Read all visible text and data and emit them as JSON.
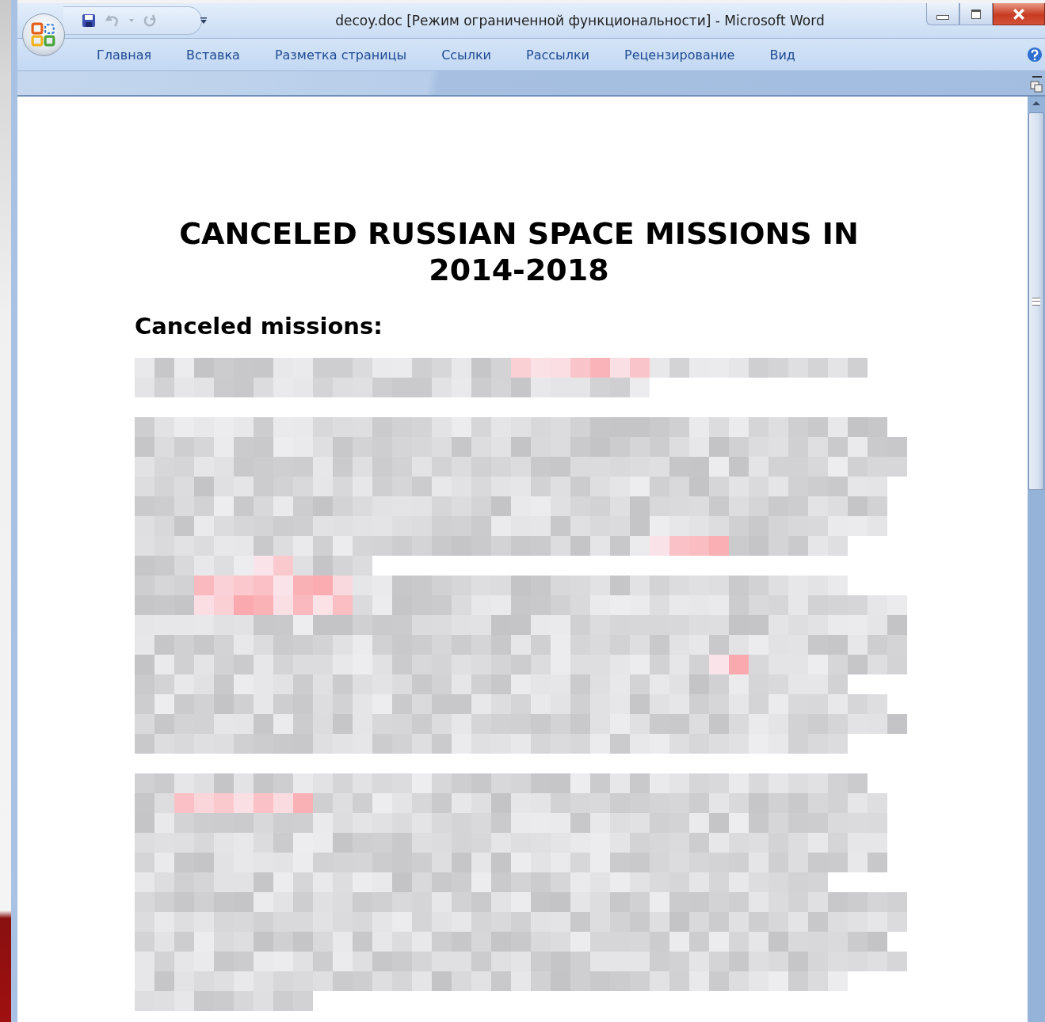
{
  "window": {
    "title": "decoy.doc [Режим ограниченной функциональности] - Microsoft Word"
  },
  "ribbon_tabs": [
    {
      "label": "Главная",
      "selected": false
    },
    {
      "label": "Вставка",
      "selected": false
    },
    {
      "label": "Разметка страницы",
      "selected": false
    },
    {
      "label": "Ссылки",
      "selected": false
    },
    {
      "label": "Рассылки",
      "selected": false
    },
    {
      "label": "Рецензирование",
      "selected": false
    },
    {
      "label": "Вид",
      "selected": false
    }
  ],
  "document": {
    "title": "CANCELED RUSSIAN SPACE MISSIONS IN 2014-2018",
    "heading": "Canceled missions:"
  }
}
